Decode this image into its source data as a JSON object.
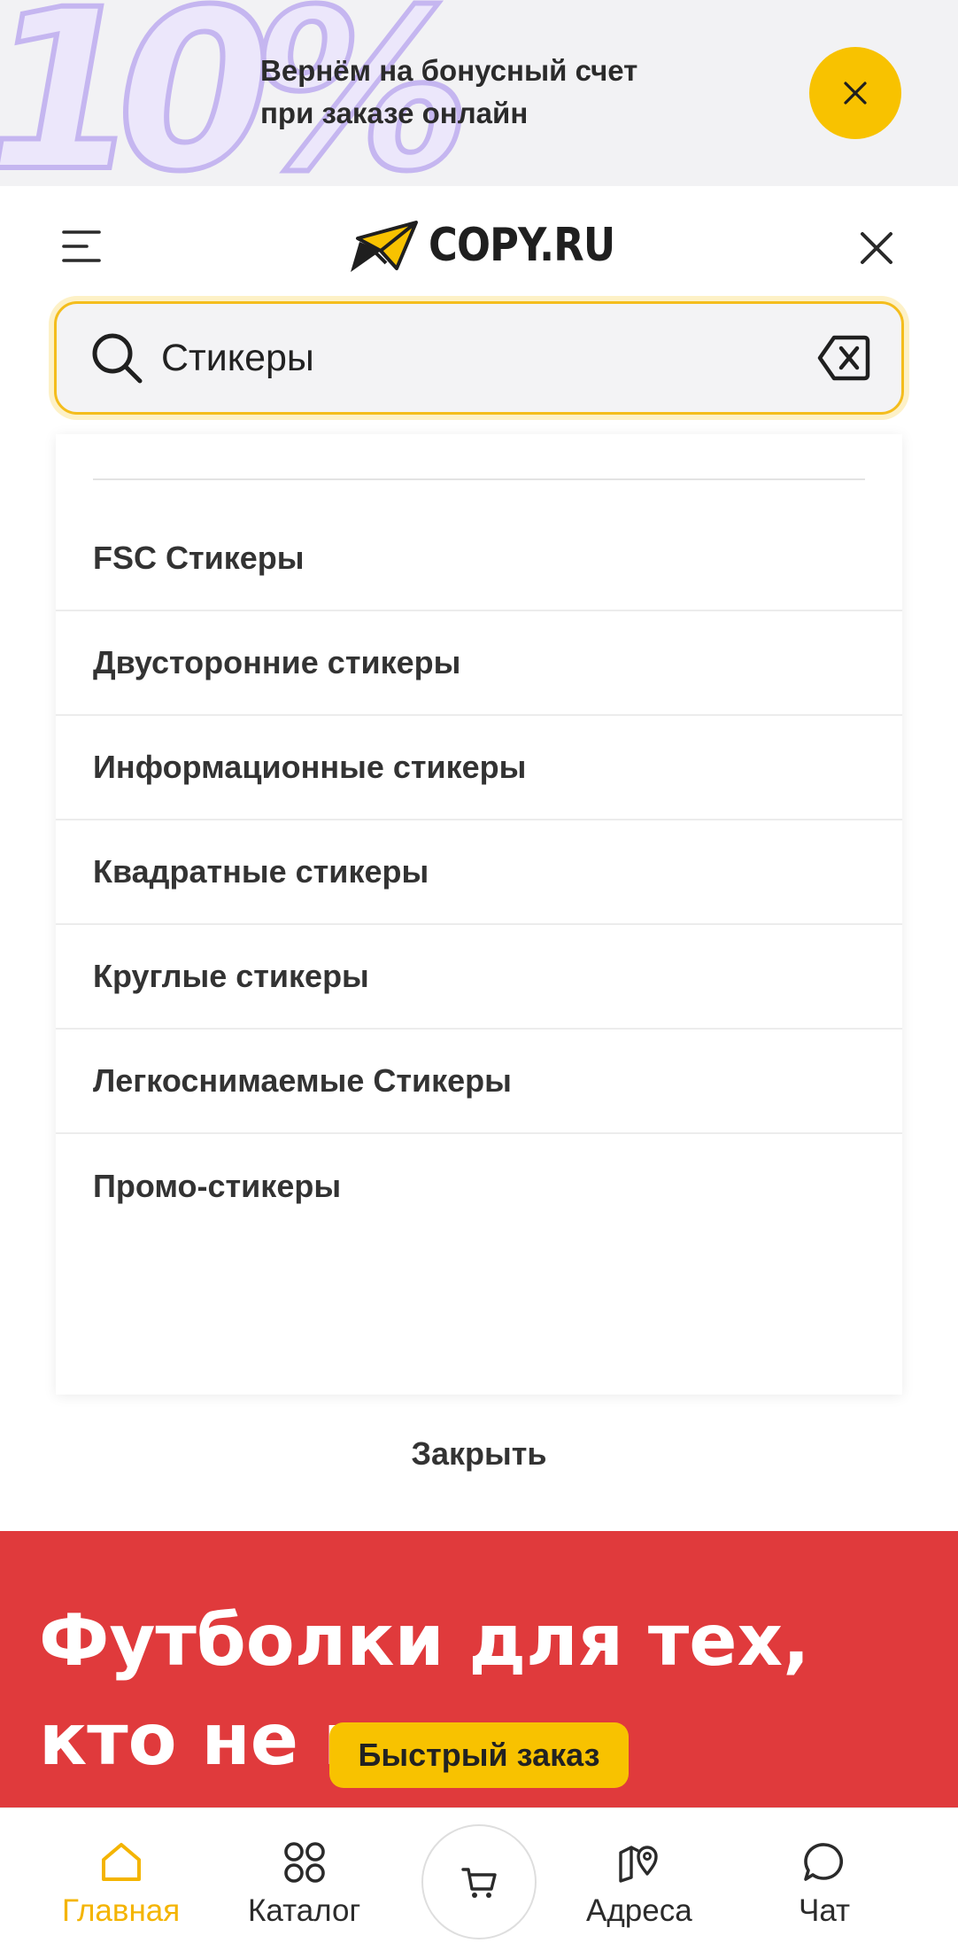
{
  "promo": {
    "big_text": "10%",
    "line1": "Вернём на бонусный счет",
    "line2": "при заказе онлайн"
  },
  "header": {
    "logo_text": "COPY.RU"
  },
  "search": {
    "value": "Стикеры"
  },
  "suggestions": [
    "FSC Стикеры",
    "Двусторонние стикеры",
    "Информационные стикеры",
    "Квадратные стикеры",
    "Круглые стикеры",
    "Легкоснимаемые Стикеры",
    "Промо-стикеры"
  ],
  "close_label": "Закрыть",
  "banner": {
    "line1": "Футболки для тех,",
    "line2": "кто не в"
  },
  "quick_order_label": "Быстрый заказ",
  "nav": {
    "home": "Главная",
    "catalog": "Каталог",
    "addresses": "Адреса",
    "chat": "Чат"
  },
  "colors": {
    "accent": "#f8c200",
    "banner_red": "#e03a3c"
  }
}
